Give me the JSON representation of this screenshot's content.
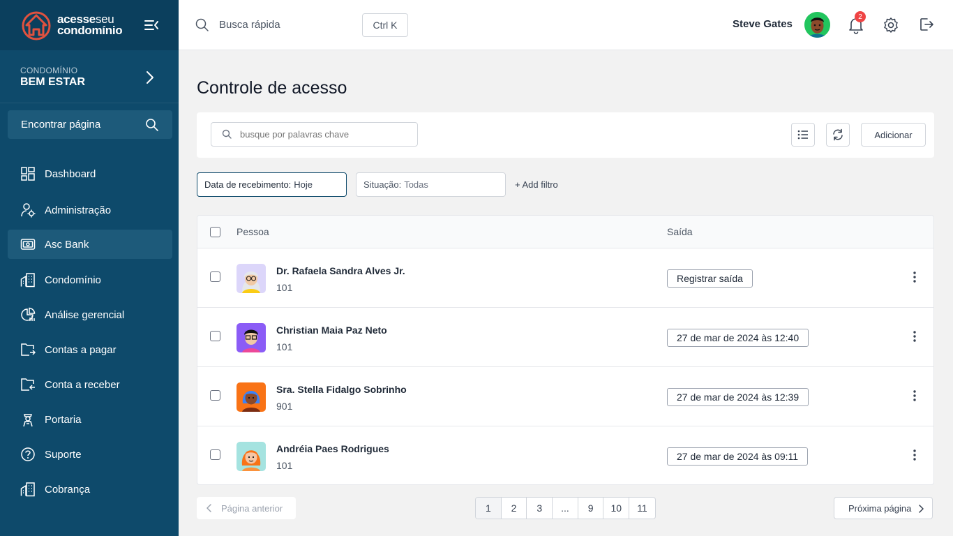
{
  "brand": {
    "word1": "acesse",
    "word2": "seu",
    "word3": "condomínio"
  },
  "condo": {
    "label": "CONDOMÍNIO",
    "name": "BEM ESTAR"
  },
  "find_page": {
    "label": "Encontrar página"
  },
  "sidebar": {
    "items": [
      {
        "label": "Dashboard",
        "icon": "dashboard-icon"
      },
      {
        "label": "Administração",
        "icon": "admin-gear-user-icon"
      },
      {
        "label": "Asc Bank",
        "icon": "bank-icon",
        "active": true
      },
      {
        "label": "Condomínio",
        "icon": "building-icon"
      },
      {
        "label": "Análise gerencial",
        "icon": "chart-icon"
      },
      {
        "label": "Contas a pagar",
        "icon": "folder-out-icon"
      },
      {
        "label": "Conta a receber",
        "icon": "folder-in-icon"
      },
      {
        "label": "Portaria",
        "icon": "doorman-icon"
      },
      {
        "label": "Suporte",
        "icon": "help-icon"
      },
      {
        "label": "Cobrança",
        "icon": "building-icon"
      }
    ]
  },
  "topbar": {
    "search_label": "Busca rápida",
    "shortcut": "Ctrl K",
    "user_name": "Steve Gates",
    "notifications": "2"
  },
  "page": {
    "title": "Controle de acesso"
  },
  "toolbar": {
    "search_placeholder": "busque por palavras chave",
    "add_label": "Adicionar"
  },
  "filters": [
    {
      "key": "Data de recebimento:",
      "value": "Hoje",
      "active": true
    },
    {
      "key": "Situação:",
      "value": "Todas",
      "active": false
    }
  ],
  "add_filter_label": "+ Add filtro",
  "table": {
    "columns": {
      "person": "Pessoa",
      "exit": "Saída"
    },
    "rows": [
      {
        "name": "Dr. Rafaela Sandra Alves Jr.",
        "unit": "101",
        "exit": "Registrar saída",
        "avatar_bg": "#dcd6fa"
      },
      {
        "name": "Christian Maia Paz Neto",
        "unit": "101",
        "exit": "27 de mar de 2024 às 12:40",
        "avatar_bg": "#8b5cf6"
      },
      {
        "name": "Sra. Stella Fidalgo Sobrinho",
        "unit": "901",
        "exit": "27 de mar de 2024 às 12:39",
        "avatar_bg": "#f97316"
      },
      {
        "name": "Andréia Paes Rodrigues",
        "unit": "101",
        "exit": "27 de mar de 2024 às 09:11",
        "avatar_bg": "#a5e3e0"
      }
    ]
  },
  "pagination": {
    "prev": "Página anterior",
    "next": "Próxima página",
    "pages": [
      "1",
      "2",
      "3",
      "...",
      "9",
      "10",
      "11"
    ],
    "current": "1"
  },
  "colors": {
    "sidebar": "#0e4a6b",
    "sidebar_dark": "#0b3f5d",
    "accent": "#e0523f"
  }
}
